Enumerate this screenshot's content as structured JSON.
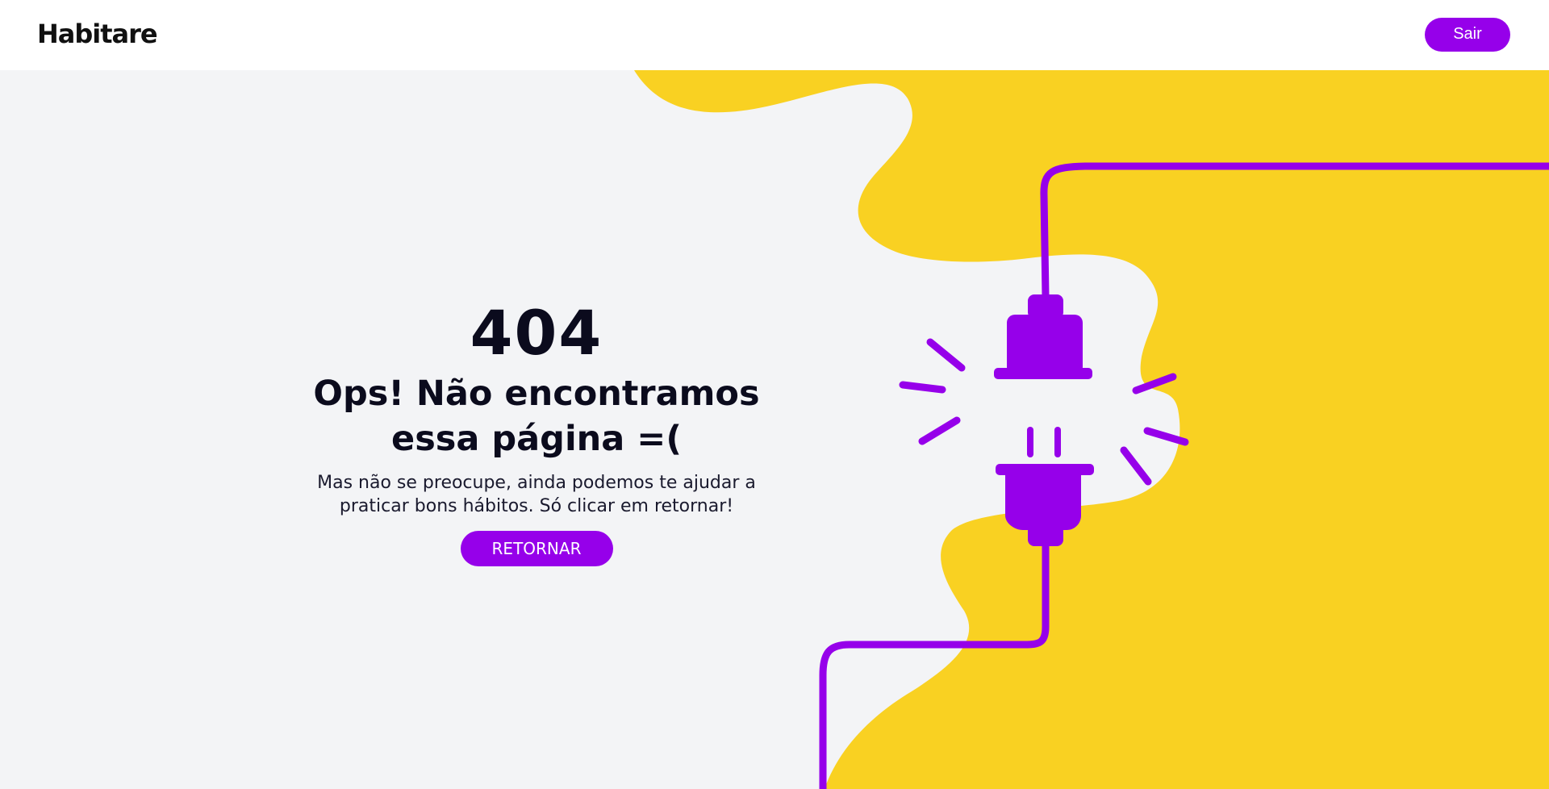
{
  "header": {
    "logo": "Habitare",
    "exit_label": "Sair"
  },
  "error": {
    "code": "404",
    "title": "Ops! Não encontramos essa página =(",
    "description": "Mas não se preocupe, ainda podemos te ajudar a praticar bons hábitos. Só clicar em retornar!",
    "return_label": "RETORNAR"
  },
  "illustration": {
    "name": "unplugged-cable-illustration"
  },
  "colors": {
    "accent": "#9600ea",
    "blob": "#f9d122",
    "background": "#f3f4f6",
    "header": "#ffffff",
    "text": "#0b0b1d"
  }
}
